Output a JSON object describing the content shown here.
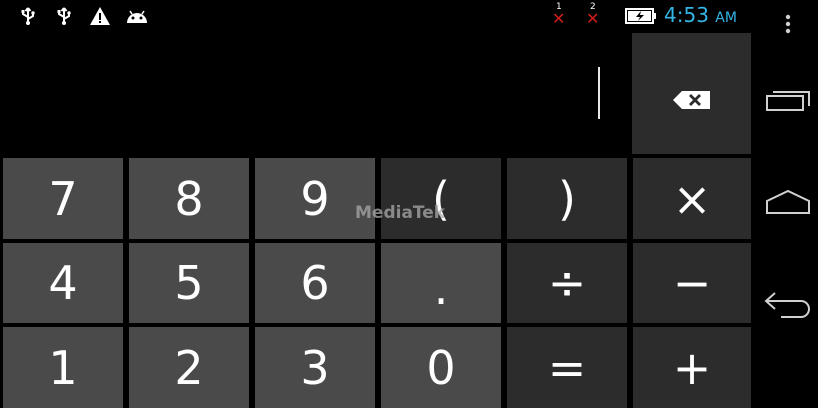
{
  "status_bar": {
    "icons": [
      "usb-icon",
      "usb-icon",
      "warning-icon",
      "android-icon"
    ],
    "sim1_label": "1",
    "sim2_label": "2",
    "time": "4:53",
    "ampm": "AM",
    "battery_icon": "battery-charging-icon",
    "colors": {
      "clock": "#33b5e5",
      "no_signal": "#d01c1c"
    }
  },
  "display": {
    "expression": ""
  },
  "keypad": {
    "backspace_icon": "backspace-icon",
    "keys": {
      "seven": "7",
      "eight": "8",
      "nine": "9",
      "open_paren": "(",
      "close_paren": ")",
      "multiply": "×",
      "four": "4",
      "five": "5",
      "six": "6",
      "dot": ".",
      "divide": "÷",
      "minus": "−",
      "one": "1",
      "two": "2",
      "three": "3",
      "zero": "0",
      "equals": "=",
      "plus": "+"
    },
    "colors": {
      "digit_key": "#4a4a4a",
      "operator_key": "#2c2c2c"
    }
  },
  "navbar": {
    "icons": [
      "menu-icon",
      "recent-apps-icon",
      "home-icon",
      "back-icon"
    ]
  },
  "watermark": "MediaTek"
}
